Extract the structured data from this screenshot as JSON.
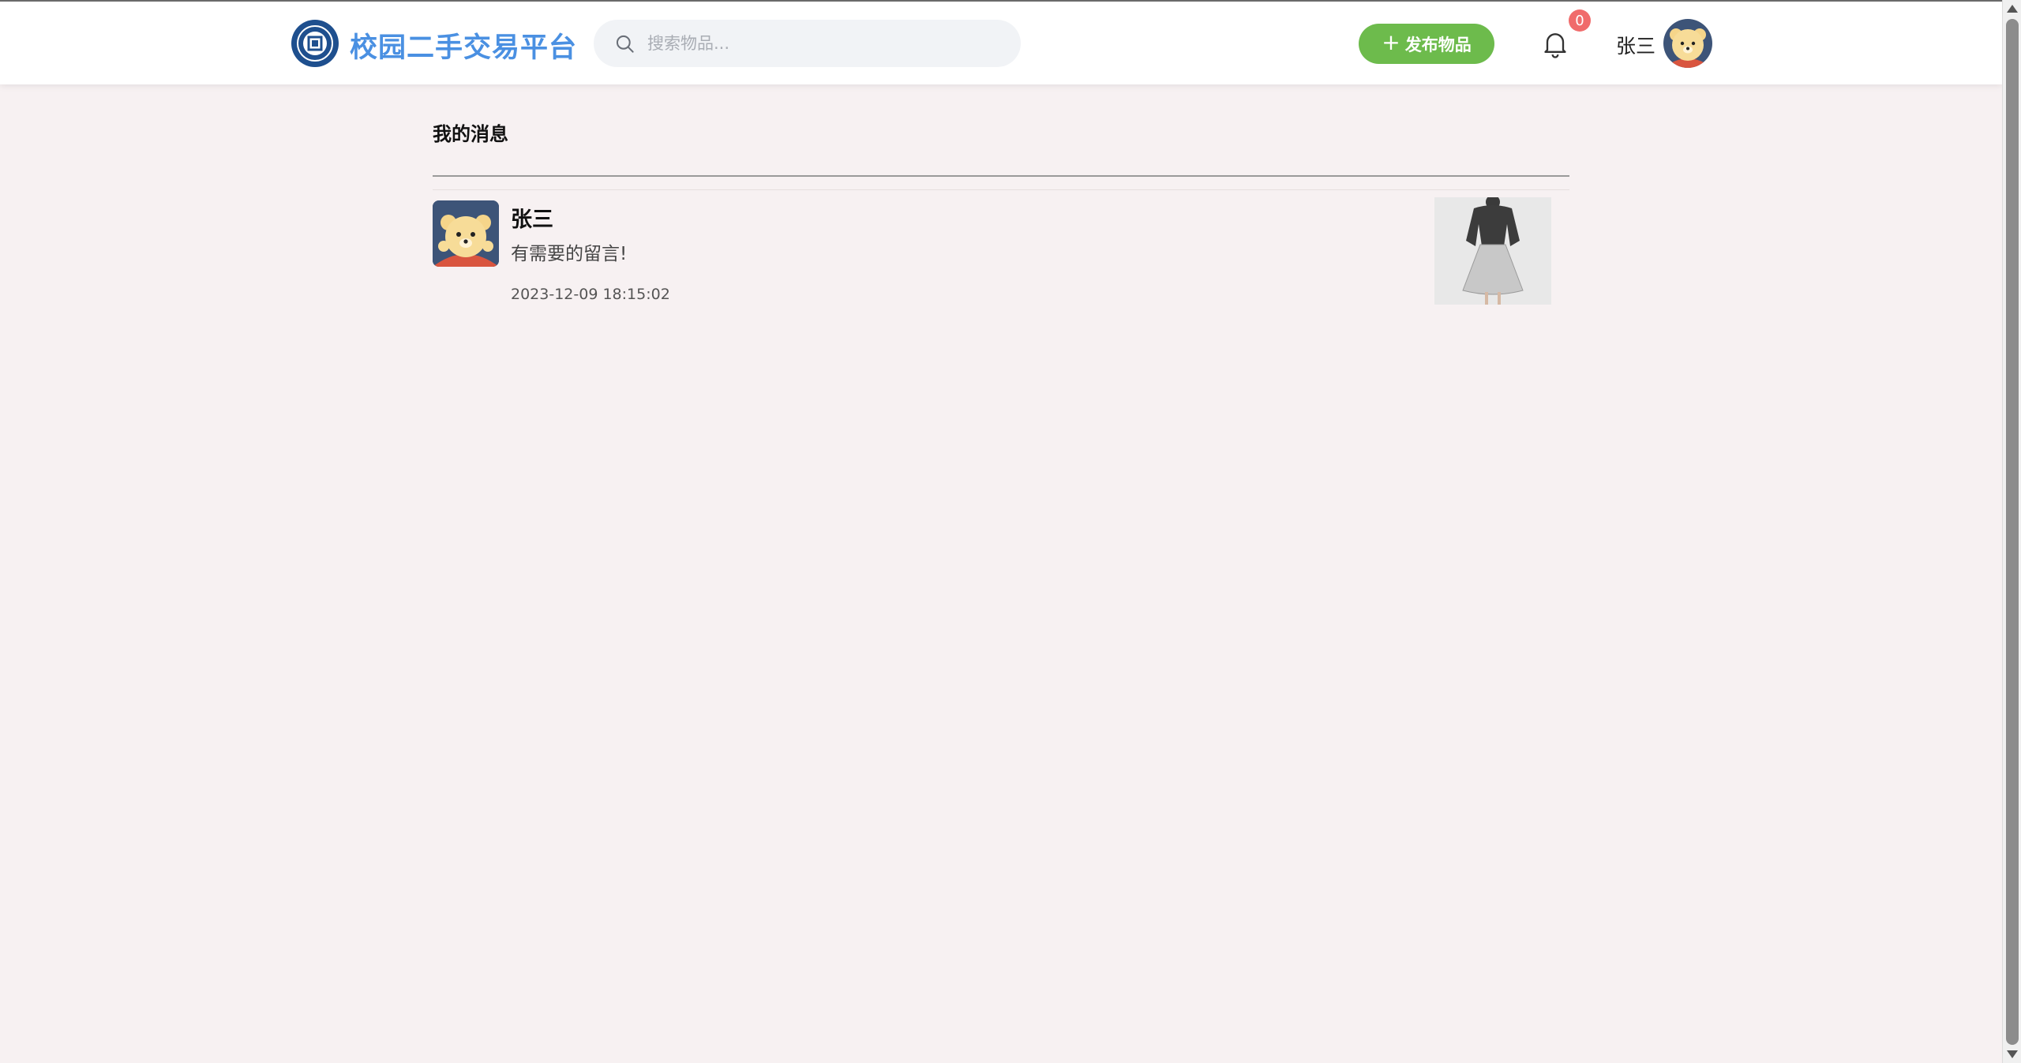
{
  "header": {
    "brand": "校园二手交易平台",
    "search_placeholder": "搜索物品...",
    "publish_label": "发布物品",
    "notification_count": "0",
    "user_name": "张三"
  },
  "messages": {
    "title": "我的消息",
    "items": [
      {
        "sender": "张三",
        "text": "有需要的留言!",
        "time": "2023-12-09 18:15:02"
      }
    ]
  },
  "colors": {
    "brand": "#4a90e2",
    "publish_button": "#6dbb4c",
    "badge": "#f06b6b",
    "background": "#f7f1f2"
  },
  "icons": [
    "logo-icon",
    "search-icon",
    "plus-icon",
    "bell-icon",
    "avatar"
  ]
}
